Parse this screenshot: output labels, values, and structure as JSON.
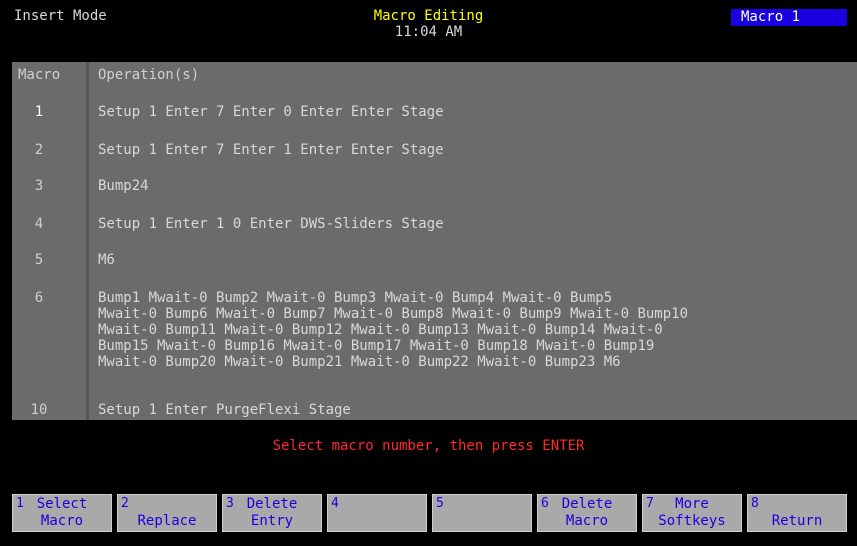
{
  "header": {
    "mode": "Insert Mode",
    "title": "Macro Editing",
    "time": "11:04 AM",
    "badge": "Macro 1",
    "badge_color": "#1a00e0"
  },
  "table": {
    "col_macro": "Macro",
    "col_operations": "Operation(s)",
    "rows": [
      {
        "num": "1",
        "ops": "Setup 1 Enter 7 Enter 0 Enter Enter Stage"
      },
      {
        "num": "2",
        "ops": "Setup 1 Enter 7 Enter 1 Enter Enter Stage"
      },
      {
        "num": "3",
        "ops": "Bump24"
      },
      {
        "num": "4",
        "ops": "Setup 1 Enter 1 0 Enter DWS-Sliders Stage"
      },
      {
        "num": "5",
        "ops": "M6"
      },
      {
        "num": "6",
        "ops": "Bump1 Mwait-0 Bump2 Mwait-0 Bump3 Mwait-0 Bump4 Mwait-0 Bump5\nMwait-0 Bump6 Mwait-0 Bump7 Mwait-0 Bump8 Mwait-0 Bump9 Mwait-0 Bump10\nMwait-0 Bump11 Mwait-0 Bump12 Mwait-0 Bump13 Mwait-0 Bump14 Mwait-0\nBump15 Mwait-0 Bump16 Mwait-0 Bump17 Mwait-0 Bump18 Mwait-0 Bump19\nMwait-0 Bump20 Mwait-0 Bump21 Mwait-0 Bump22 Mwait-0 Bump23 M6"
      },
      {
        "num": "10",
        "ops": "Setup 1 Enter PurgeFlexi Stage"
      }
    ]
  },
  "prompt": "Select macro number, then press ENTER",
  "softkeys": [
    {
      "n": "1",
      "line1": "Select",
      "line2": "Macro"
    },
    {
      "n": "2",
      "line1": "",
      "line2": "Replace"
    },
    {
      "n": "3",
      "line1": "Delete",
      "line2": "Entry"
    },
    {
      "n": "4",
      "line1": "",
      "line2": ""
    },
    {
      "n": "5",
      "line1": "",
      "line2": ""
    },
    {
      "n": "6",
      "line1": "Delete",
      "line2": "Macro"
    },
    {
      "n": "7",
      "line1": "More",
      "line2": "Softkeys"
    },
    {
      "n": "8",
      "line1": "",
      "line2": "Return"
    }
  ]
}
